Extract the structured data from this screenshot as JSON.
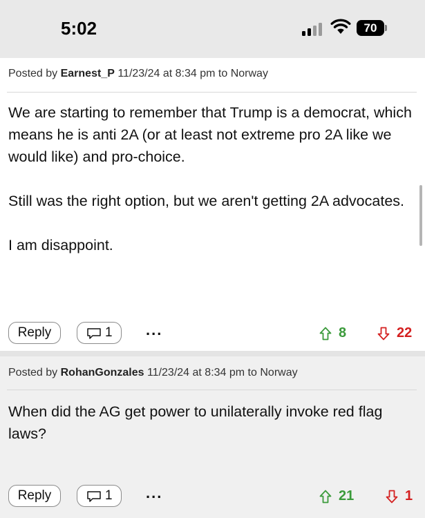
{
  "status_bar": {
    "time": "5:02",
    "battery": "70",
    "icons": [
      "signal-icon",
      "wifi-icon",
      "battery-icon"
    ]
  },
  "colors": {
    "upvote": "#3a9a3a",
    "downvote": "#d42020",
    "status_bg": "#e9e9e9",
    "alt_comment_bg": "#f0f0f0"
  },
  "comments": [
    {
      "posted_by_prefix": "Posted by",
      "author": "Earnest_P",
      "timestamp": "11/23/24 at 8:34 pm to",
      "location": "Norway",
      "paragraphs": [
        "We are starting to remember that Trump is a democrat, which means he is anti 2A (or at least not extreme pro 2A like we would like) and pro-choice.",
        "Still was the right option, but we aren't getting 2A advocates.",
        "I am disappoint."
      ],
      "reply_label": "Reply",
      "reply_count": "1",
      "more": "...",
      "upvotes": "8",
      "downvotes": "22"
    },
    {
      "posted_by_prefix": "Posted by",
      "author": "RohanGonzales",
      "timestamp": "11/23/24 at 8:34 pm to",
      "location": "Norway",
      "paragraphs": [
        "When did the AG get power to unilaterally invoke red flag laws?"
      ],
      "reply_label": "Reply",
      "reply_count": "1",
      "more": "...",
      "upvotes": "21",
      "downvotes": "1"
    }
  ]
}
